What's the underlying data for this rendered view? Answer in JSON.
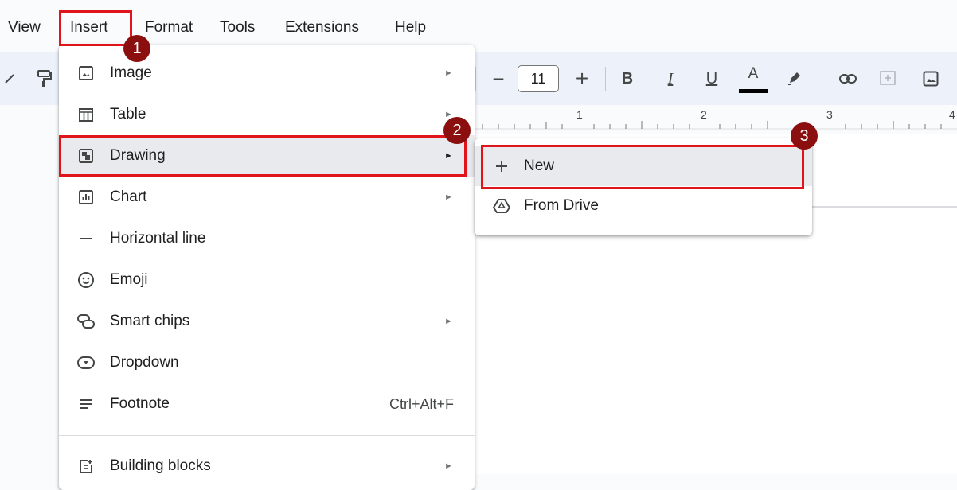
{
  "menubar": {
    "items": [
      "View",
      "Insert",
      "Format",
      "Tools",
      "Extensions",
      "Help"
    ]
  },
  "toolbar": {
    "font_size": "11",
    "decrease_symbol": "−",
    "increase_symbol": "+",
    "bold": "B",
    "italic": "I",
    "underline": "U",
    "text_color": "A",
    "icons": [
      "brush-icon",
      "paint-format-icon",
      "bold-icon",
      "italic-icon",
      "underline-icon",
      "text-color-icon",
      "highlight-icon",
      "link-icon",
      "add-comment-icon",
      "insert-image-icon"
    ],
    "text_color_swatch": "#000000"
  },
  "ruler": {
    "numbers": [
      "1",
      "2",
      "3",
      "4"
    ]
  },
  "insert_menu": {
    "items": [
      {
        "label": "Image",
        "icon": "image-icon",
        "submenu": true
      },
      {
        "label": "Table",
        "icon": "table-icon",
        "submenu": true
      },
      {
        "label": "Drawing",
        "icon": "drawing-icon",
        "submenu": true
      },
      {
        "label": "Chart",
        "icon": "chart-icon",
        "submenu": true
      },
      {
        "label": "Horizontal line",
        "icon": "horizontal-line-icon",
        "submenu": false
      },
      {
        "label": "Emoji",
        "icon": "emoji-icon",
        "submenu": false
      },
      {
        "label": "Smart chips",
        "icon": "smart-chips-icon",
        "submenu": true
      },
      {
        "label": "Dropdown",
        "icon": "dropdown-icon",
        "submenu": false
      },
      {
        "label": "Footnote",
        "icon": "footnote-icon",
        "submenu": false,
        "shortcut": "Ctrl+Alt+F"
      },
      {
        "label": "Building blocks",
        "icon": "building-blocks-icon",
        "submenu": true
      }
    ],
    "arrow_glyph": "►"
  },
  "drawing_submenu": {
    "items": [
      {
        "label": "New",
        "icon": "plus-icon"
      },
      {
        "label": "From Drive",
        "icon": "drive-icon"
      }
    ]
  },
  "annotations": {
    "steps": [
      "1",
      "2",
      "3"
    ],
    "box_color": "#e0141b",
    "badge_color": "#8b0f0f"
  }
}
